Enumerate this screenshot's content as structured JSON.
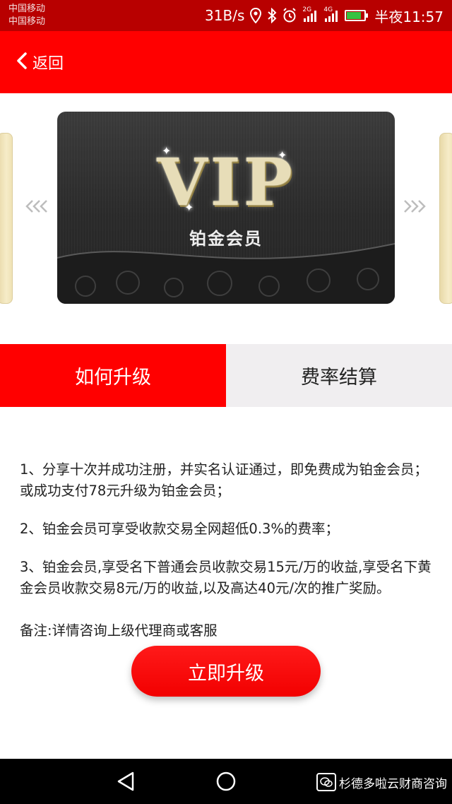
{
  "status_bar": {
    "carrier_1": "中国移动",
    "carrier_2": "中国移动",
    "speed": "31B/s",
    "network_2g": "2G",
    "network_4g": "4G",
    "time": "半夜11:57",
    "icons": [
      "location-icon",
      "bluetooth-icon",
      "alarm-icon",
      "signal-icon",
      "battery-icon"
    ]
  },
  "header": {
    "back_label": "返回"
  },
  "carousel": {
    "card_logo": "VIP",
    "card_subtitle": "铂金会员",
    "prev_arrow": "«‹",
    "next_arrow": "›»"
  },
  "tabs": [
    {
      "label": "如何升级",
      "active": true
    },
    {
      "label": "费率结算",
      "active": false
    }
  ],
  "content": {
    "item_1": "1、分享十次并成功注册，并实名认证通过，即免费成为铂金会员；或成功支付78元升级为铂金会员；",
    "item_2": "2、铂金会员可享受收款交易全网超低0.3%的费率；",
    "item_3": "3、铂金会员,享受名下普通会员收款交易15元/万的收益,享受名下黄金会员收款交易8元/万的收益,以及高达40元/次的推广奖励。",
    "note": "备注:详情咨询上级代理商或客服"
  },
  "upgrade_button": "立即升级",
  "watermark": "杉德多啦云财商咨询",
  "colors": {
    "status_bar": "#b80000",
    "brand_red": "#ff0000",
    "tab_inactive": "#f0eef0",
    "nav_bar": "#000000"
  }
}
